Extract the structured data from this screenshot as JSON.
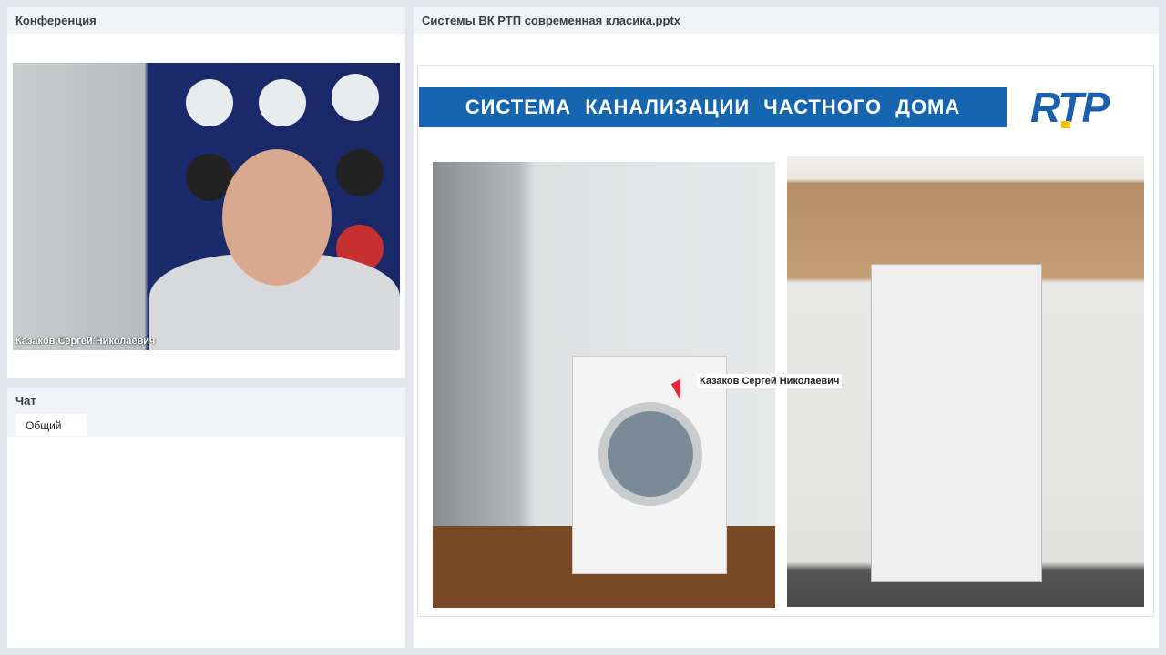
{
  "conference": {
    "title": "Конференция",
    "speaker_name": "Казаков Сергей Николаевич"
  },
  "chat": {
    "title": "Чат",
    "tabs": [
      {
        "label": "Общий"
      }
    ]
  },
  "presentation": {
    "title": "Системы ВК РТП современная класика.pptx",
    "slide": {
      "heading": "СИСТЕМА  КАНАЛИЗАЦИИ  ЧАСТНОГО  ДОМА",
      "logo": "RTP",
      "pointer_label": "Казаков Сергей Николаевич"
    }
  },
  "colors": {
    "banner": "#1565b0",
    "pointer": "#e8243a",
    "logo_accent": "#f2c200"
  }
}
